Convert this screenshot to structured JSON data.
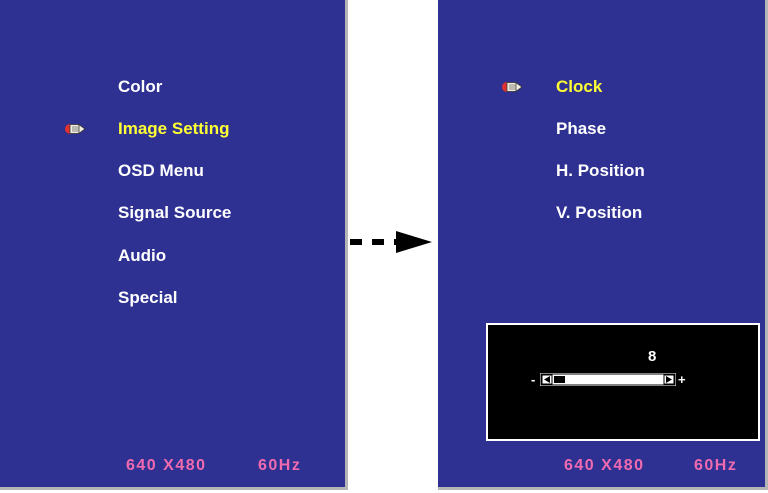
{
  "main_menu": {
    "items": [
      {
        "label": "Color",
        "selected": false
      },
      {
        "label": "Image Setting",
        "selected": true
      },
      {
        "label": "OSD Menu",
        "selected": false
      },
      {
        "label": "Signal Source",
        "selected": false
      },
      {
        "label": "Audio",
        "selected": false
      },
      {
        "label": "Special",
        "selected": false
      }
    ],
    "resolution": "640 X480",
    "refresh_rate": "60Hz"
  },
  "sub_menu": {
    "items": [
      {
        "label": "Clock",
        "selected": true
      },
      {
        "label": "Phase",
        "selected": false
      },
      {
        "label": "H. Position",
        "selected": false
      },
      {
        "label": "V. Position",
        "selected": false
      }
    ],
    "adjust": {
      "value": "8",
      "slider_fraction": 0.18,
      "minus_symbol": "-",
      "plus_symbol": "+"
    },
    "resolution": "640 X480",
    "refresh_rate": "60Hz"
  },
  "colors": {
    "panel_bg": "#2e3192",
    "selected_text": "#ffff33",
    "normal_text": "#ffffff",
    "status_text": "#f06ab0"
  },
  "icons": [
    "menu-cursor-icon",
    "dashed-arrow-icon"
  ]
}
